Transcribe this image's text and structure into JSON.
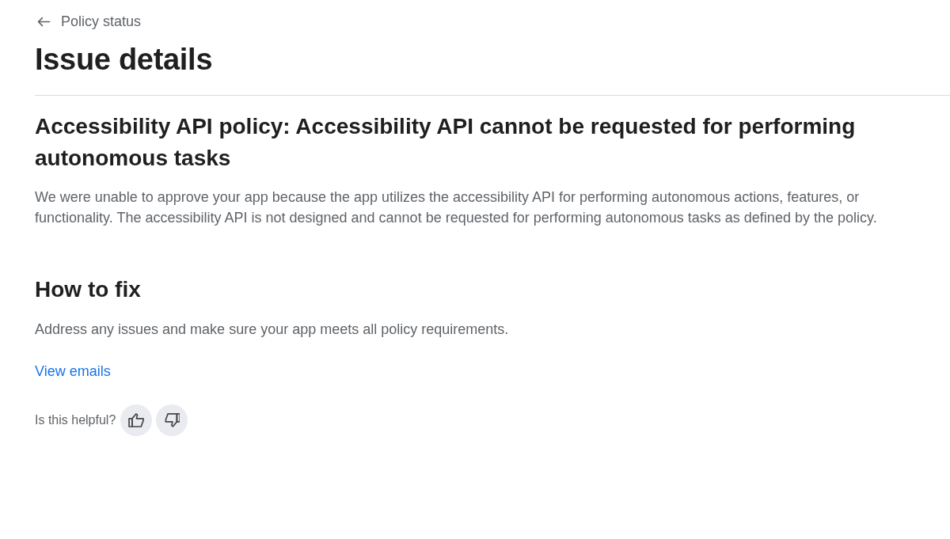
{
  "back_link": {
    "label": "Policy status"
  },
  "page_title": "Issue details",
  "issue": {
    "title": "Accessibility API policy: Accessibility API cannot be requested for performing autonomous tasks",
    "description": "We were unable to approve your app because the app utilizes the accessibility API for performing autonomous actions, features, or functionality. The accessibility API is not designed and cannot be requested for performing autonomous tasks as defined by the policy."
  },
  "fix": {
    "heading": "How to fix",
    "text": "Address any issues and make sure your app meets all policy requirements.",
    "link": "View emails"
  },
  "feedback": {
    "question": "Is this helpful?",
    "buttons": [
      {
        "kind": "up"
      },
      {
        "kind": "down"
      }
    ]
  }
}
